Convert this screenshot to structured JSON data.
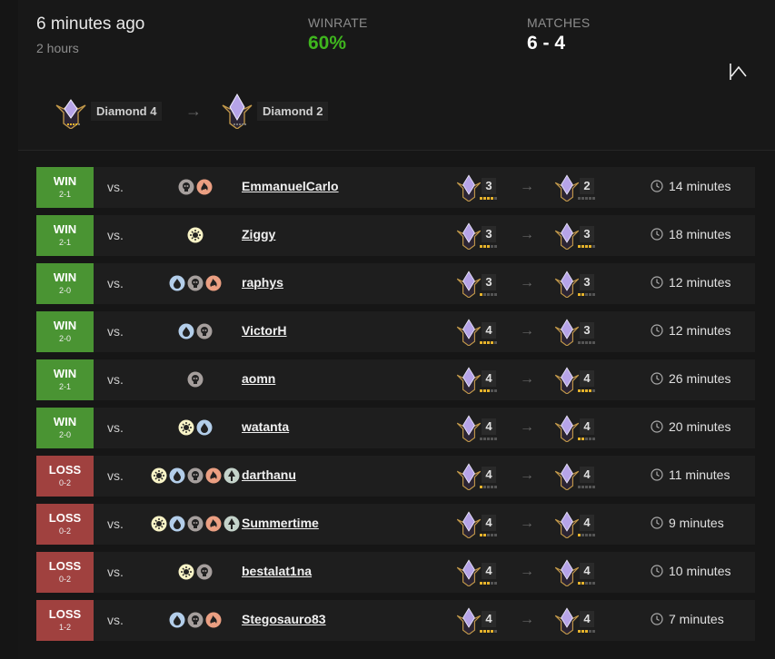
{
  "header": {
    "time_ago": "6 minutes ago",
    "duration": "2 hours",
    "winrate_label": "WINRATE",
    "winrate_value": "60%",
    "matches_label": "MATCHES",
    "matches_value": "6 - 4",
    "start_rank": "Diamond 4",
    "end_rank": "Diamond 2",
    "arrow": "→",
    "colors": {
      "winrate": "#3fb61e",
      "win": "#4a9433",
      "loss": "#a0413f",
      "pip_on": "#e6b32b"
    }
  },
  "vs_label": "vs.",
  "arrow_glyph": "→",
  "matches": [
    {
      "result": "WIN",
      "score": "2-1",
      "mana": [
        "B",
        "R"
      ],
      "opponent": "EmmanuelCarlo",
      "rank_before": "3",
      "rank_after": "2",
      "pips_before": 4,
      "pips_after": 0,
      "time": "14 minutes"
    },
    {
      "result": "WIN",
      "score": "2-1",
      "mana": [
        "W"
      ],
      "opponent": "Ziggy",
      "rank_before": "3",
      "rank_after": "3",
      "pips_before": 3,
      "pips_after": 4,
      "time": "18 minutes"
    },
    {
      "result": "WIN",
      "score": "2-0",
      "mana": [
        "U",
        "B",
        "R"
      ],
      "opponent": "raphys",
      "rank_before": "3",
      "rank_after": "3",
      "pips_before": 1,
      "pips_after": 2,
      "time": "12 minutes"
    },
    {
      "result": "WIN",
      "score": "2-0",
      "mana": [
        "U",
        "B"
      ],
      "opponent": "VictorH",
      "rank_before": "4",
      "rank_after": "3",
      "pips_before": 4,
      "pips_after": 0,
      "time": "12 minutes"
    },
    {
      "result": "WIN",
      "score": "2-1",
      "mana": [
        "B"
      ],
      "opponent": "aomn",
      "rank_before": "4",
      "rank_after": "4",
      "pips_before": 3,
      "pips_after": 4,
      "time": "26 minutes"
    },
    {
      "result": "WIN",
      "score": "2-0",
      "mana": [
        "W",
        "U"
      ],
      "opponent": "watanta",
      "rank_before": "4",
      "rank_after": "4",
      "pips_before": 0,
      "pips_after": 2,
      "time": "20 minutes"
    },
    {
      "result": "LOSS",
      "score": "0-2",
      "mana": [
        "W",
        "U",
        "B",
        "R",
        "G"
      ],
      "opponent": "darthanu",
      "rank_before": "4",
      "rank_after": "4",
      "pips_before": 1,
      "pips_after": 0,
      "time": "11 minutes"
    },
    {
      "result": "LOSS",
      "score": "0-2",
      "mana": [
        "W",
        "U",
        "B",
        "R",
        "G"
      ],
      "opponent": "Summertime",
      "rank_before": "4",
      "rank_after": "4",
      "pips_before": 2,
      "pips_after": 1,
      "time": "9 minutes"
    },
    {
      "result": "LOSS",
      "score": "0-2",
      "mana": [
        "W",
        "B"
      ],
      "opponent": "bestalat1na",
      "rank_before": "4",
      "rank_after": "4",
      "pips_before": 3,
      "pips_after": 2,
      "time": "10 minutes"
    },
    {
      "result": "LOSS",
      "score": "1-2",
      "mana": [
        "U",
        "B",
        "R"
      ],
      "opponent": "Stegosauro83",
      "rank_before": "4",
      "rank_after": "4",
      "pips_before": 4,
      "pips_after": 3,
      "time": "7 minutes"
    }
  ],
  "icons": {
    "clock": "clock-icon",
    "collapse": "chevron-up-icon",
    "rank": "diamond-rank-icon"
  },
  "mana_colors": {
    "W": "#f8f3c6",
    "U": "#b3ceea",
    "B": "#a69f9d",
    "R": "#eb9f82",
    "G": "#c4d3ca"
  }
}
